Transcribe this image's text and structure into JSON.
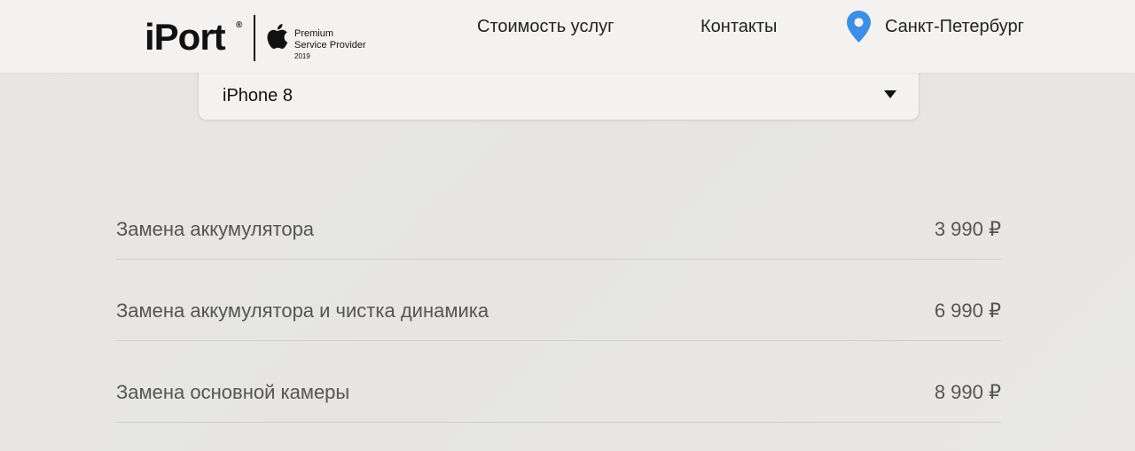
{
  "header": {
    "logo_text": "iPort",
    "logo_registered": "®",
    "provider_line1": "Premium",
    "provider_line2": "Service Provider",
    "provider_year": "2019",
    "nav": {
      "services": "Стоимость услуг",
      "contacts": "Контакты"
    },
    "city": "Санкт-Петербург",
    "pin_color": "#3d8fe6"
  },
  "model_select": {
    "value": "iPhone 8"
  },
  "services": [
    {
      "name": "Замена аккумулятора",
      "price": "3 990 ₽"
    },
    {
      "name": "Замена аккумулятора и чистка динамика",
      "price": "6 990 ₽"
    },
    {
      "name": "Замена основной камеры",
      "price": "8 990 ₽"
    }
  ]
}
